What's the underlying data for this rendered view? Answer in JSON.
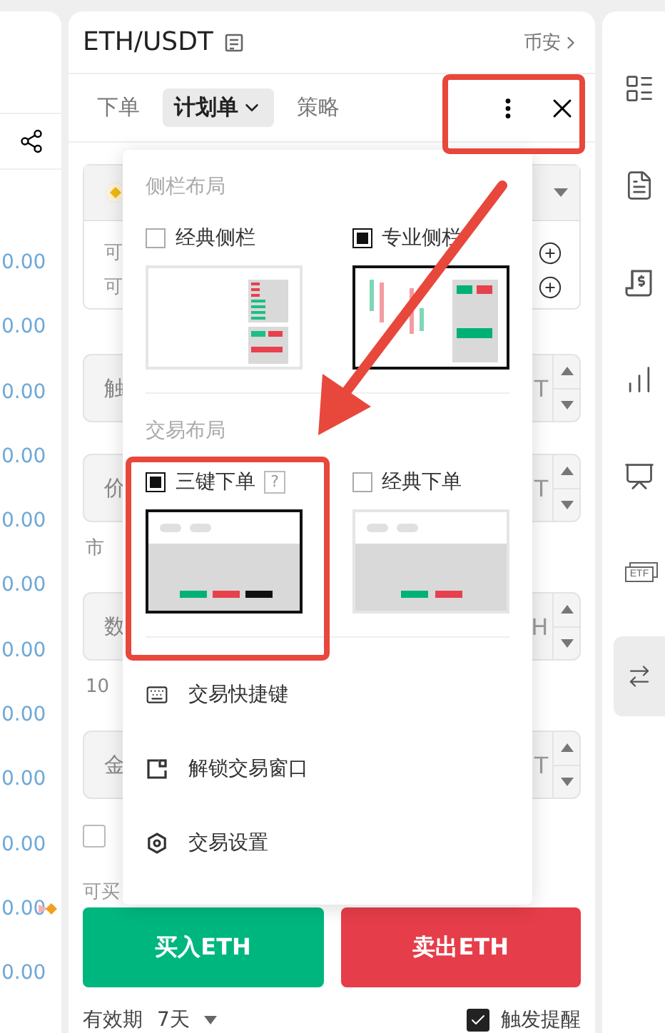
{
  "chart_panel": {
    "prices": [
      "0.00",
      "0.00",
      "0.00",
      "0.00",
      "0.00",
      "0.00",
      "0.00",
      "0.00",
      "0.00",
      "0.00",
      "0.00",
      "0.00"
    ]
  },
  "order_panel": {
    "symbol": "ETH/USDT",
    "exchange": "币安",
    "tabs": [
      {
        "label": "下单",
        "selected": false,
        "kind": "plain"
      },
      {
        "label": "计划单",
        "selected": true,
        "kind": "dropdown"
      },
      {
        "label": "策略",
        "selected": false,
        "kind": "plain"
      }
    ],
    "form": {
      "asset_rows": [
        "可",
        "可"
      ],
      "fields": [
        {
          "label": "触",
          "unit": "T"
        },
        {
          "label": "价",
          "unit": "T",
          "note": "市"
        },
        {
          "label": "数",
          "unit": "H",
          "note": "10"
        },
        {
          "label": "金",
          "unit": "T"
        }
      ],
      "agree_checked": false,
      "available": "可买"
    },
    "buy_button": "买入ETH",
    "sell_button": "卖出ETH",
    "validity_label": "有效期",
    "validity_value": "7天",
    "trigger_alert": {
      "label": "触发提醒",
      "checked": true
    }
  },
  "menu": {
    "sections": [
      {
        "title": "侧栏布局",
        "options": [
          {
            "label": "经典侧栏",
            "selected": false,
            "kind": "classic-sidebar"
          },
          {
            "label": "专业侧栏",
            "selected": true,
            "kind": "pro-sidebar"
          }
        ]
      },
      {
        "title": "交易布局",
        "options": [
          {
            "label": "三键下单",
            "selected": true,
            "kind": "three-key",
            "help": "?"
          },
          {
            "label": "经典下单",
            "selected": false,
            "kind": "classic-order"
          }
        ]
      }
    ],
    "items": [
      "交易快捷键",
      "解锁交易窗口",
      "交易设置"
    ]
  },
  "sidebar": {
    "items": [
      {
        "selected": false
      },
      {
        "selected": false
      },
      {
        "selected": false
      },
      {
        "selected": false
      },
      {
        "selected": false
      },
      {
        "selected": false,
        "badge": "ETF"
      },
      {
        "selected": true
      }
    ]
  }
}
